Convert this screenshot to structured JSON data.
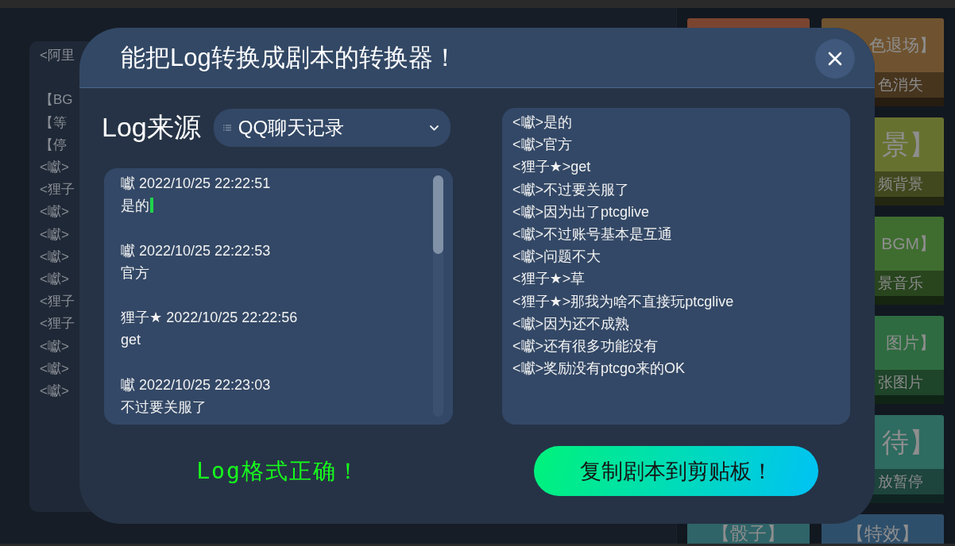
{
  "script_preview": {
    "blocks": [
      {
        "lines": [
          "<阿里"
        ]
      },
      {
        "lines": [
          "【BG",
          "【等",
          "【停",
          "<囐>",
          "<狸子",
          "<囐>",
          "<囐>",
          "<囐>",
          "<囐>",
          "<狸子",
          "<狸子",
          "<囐>",
          "<囐>",
          "<囐>"
        ]
      }
    ]
  },
  "command_cards": {
    "left": [
      {
        "color": "#7a4530"
      },
      {
        "color": "#2f6468",
        "title": "【骰子】"
      }
    ],
    "right": [
      {
        "color": "#6f5330",
        "title": "色退场】",
        "subtitle": "色消失"
      },
      {
        "color": "#67712f",
        "title": "景】",
        "subtitle": "频背景"
      },
      {
        "color": "#3f6d30",
        "title": "BGM】",
        "subtitle": "景音乐"
      },
      {
        "color": "#2f6b40",
        "title": "图片】",
        "subtitle": "张图片"
      },
      {
        "color": "#2e6b60",
        "title": "待】",
        "subtitle": "放暂停"
      },
      {
        "color": "#2e4f6b",
        "title": "【特效】"
      }
    ]
  },
  "dialog": {
    "title": "能把Log转换成剧本的转换器！",
    "source": {
      "label": "Log来源",
      "value": "QQ聊天记录"
    },
    "log_input": {
      "entries": [
        {
          "header": "囐 2022/10/25 22:22:51",
          "message": "是的",
          "caret": true
        },
        {
          "header": "囐 2022/10/25 22:22:53",
          "message": "官方",
          "caret": false
        },
        {
          "header": "狸子★ 2022/10/25 22:22:56",
          "message": "get",
          "caret": false
        },
        {
          "header": "囐 2022/10/25 22:23:03",
          "message": "不过要关服了",
          "caret": false
        }
      ]
    },
    "script_output": {
      "lines": [
        "<囐>是的",
        "<囐>官方",
        "<狸子★>get",
        "<囐>不过要关服了",
        "<囐>因为出了ptcglive",
        "<囐>不过账号基本是互通",
        "<囐>问题不大",
        "<狸子★>草",
        "<狸子★>那我为啥不直接玩ptcglive",
        "<囐>因为还不成熟",
        "<囐>还有很多功能没有",
        "<囐>奖励没有ptcgo来的OK"
      ]
    },
    "status": {
      "text": "Log格式正确！",
      "kind": "valid"
    },
    "copy_button": {
      "label": "复制剧本到剪贴板！"
    }
  }
}
